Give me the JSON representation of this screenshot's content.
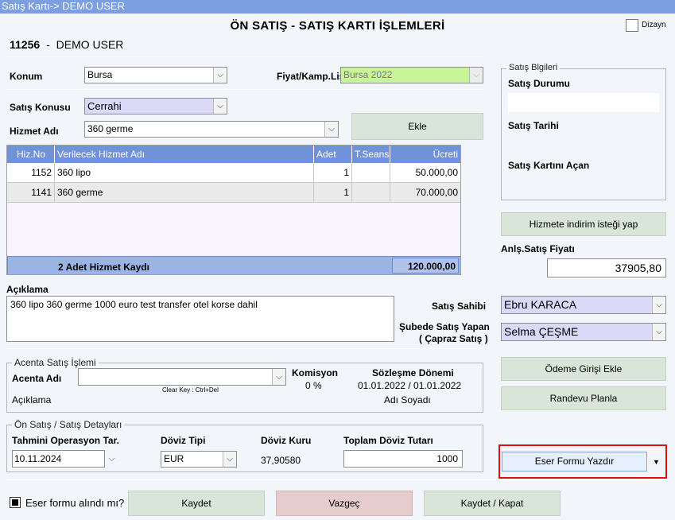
{
  "window": {
    "title": "Satış Kartı-> DEMO USER"
  },
  "header": {
    "title": "ÖN SATIŞ - SATIŞ KARTI İŞLEMLERİ",
    "user_id": "11256",
    "separator": "-",
    "user_name": "DEMO USER",
    "dizayn_label": "Dizayn"
  },
  "form": {
    "konum_label": "Konum",
    "konum_value": "Bursa",
    "fiyat_label": "Fiyat/Kamp.Lis",
    "fiyat_value": "Bursa 2022",
    "satis_konusu_label": "Satış Konusu",
    "satis_konusu_value": "Cerrahi",
    "hizmet_label": "Hizmet Adı",
    "hizmet_value": "360 germe",
    "ekle_label": "Ekle"
  },
  "table": {
    "headers": [
      "Hiz.No",
      "Verilecek Hizmet Adı",
      "Adet",
      "T.Seans",
      "Ücreti"
    ],
    "rows": [
      {
        "no": "1152",
        "name": "360 lipo",
        "adet": "1",
        "seans": "",
        "ucret": "50.000,00"
      },
      {
        "no": "1141",
        "name": "360 germe",
        "adet": "1",
        "seans": "",
        "ucret": "70.000,00"
      }
    ],
    "footer_count": "2 Adet Hizmet Kaydı",
    "footer_total": "120.000,00"
  },
  "satis_bilgileri": {
    "group_label": "Satış Blgileri",
    "durum_label": "Satış Durumu",
    "durum_value": "",
    "tarih_label": "Satış Tarihi",
    "acan_label": "Satış Kartını Açan"
  },
  "indirim": {
    "button": "Hizmete indirim isteği yap",
    "fiyat_label": "Anlş.Satış Fiyatı",
    "fiyat_value": "37905,80"
  },
  "aciklama": {
    "label": "Açıklama",
    "value": "360 lipo 360 germe 1000 euro test transfer otel korse dahil"
  },
  "satis_sahibi": {
    "label": "Satış Sahibi",
    "value": "Ebru KARACA"
  },
  "sube": {
    "label1": "Şubede Satış Yapan",
    "label2": "( Çapraz Satış )",
    "value": "Selma ÇEŞME"
  },
  "acenta": {
    "group_label": "Acenta Satış İşlemi",
    "adi_label": "Acenta Adı",
    "adi_value": "",
    "clear_key": "Clear Key : Ctrl+Del",
    "komisyon_label": "Komisyon",
    "komisyon_value": "0 %",
    "sozlesme_label": "Sözleşme Dönemi",
    "sozlesme_value": "01.01.2022 / 01.01.2022",
    "aciklama_label": "Açıklama",
    "adi_soyadi_label": "Adı Soyadı"
  },
  "detay": {
    "group_label": "Ön Satış / Satış Detayları",
    "tarih_label": "Tahmini Operasyon Tar.",
    "tarih_value": "10.11.2024",
    "doviz_tipi_label": "Döviz Tipi",
    "doviz_tipi_value": "EUR",
    "doviz_kuru_label": "Döviz Kuru",
    "doviz_kuru_value": "37,90580",
    "toplam_label": "Toplam Döviz Tutarı",
    "toplam_value": "1000"
  },
  "right_buttons": {
    "odeme": "Ödeme Girişi Ekle",
    "randevu": "Randevu Planla",
    "eser": "Eser Formu Yazdır"
  },
  "footer": {
    "eser_check_label": "Eser formu alındı mı?",
    "kaydet": "Kaydet",
    "vazgec": "Vazgeç",
    "kaydet_kapat": "Kaydet / Kapat"
  },
  "colors": {
    "titlebar": "#7b9fe0",
    "grid_header": "#6f92d8",
    "button_green": "#d8e5d8",
    "button_red": "#e6cccc",
    "highlight_border": "#dd1111",
    "fiyat_bg": "#c8f59a",
    "lavender": "#dcd8f8"
  }
}
